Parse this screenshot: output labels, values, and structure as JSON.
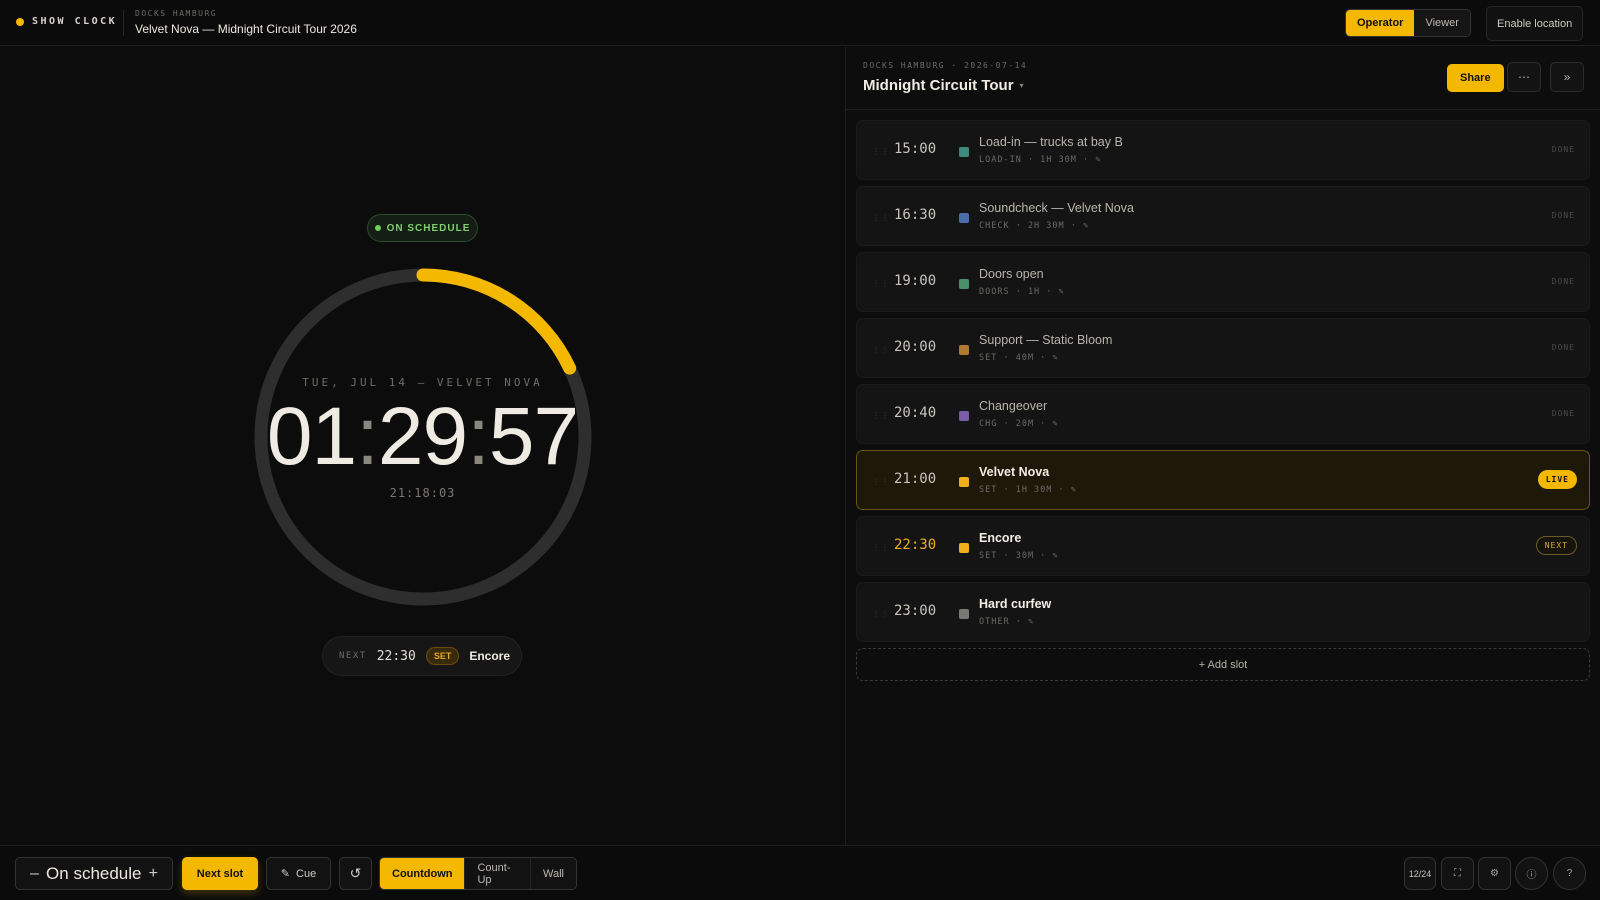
{
  "header": {
    "brand": "SHOW CLOCK",
    "venue": "DOCKS HAMBURG",
    "title": "Velvet Nova — Midnight Circuit Tour 2026",
    "roles": [
      "Operator",
      "Viewer"
    ],
    "active_role": "Operator",
    "enable_location": "Enable location"
  },
  "clock": {
    "status": "ON SCHEDULE",
    "subtitle": "TUE, JUL 14 — VELVET NOVA",
    "hh": "01",
    "mm": "29",
    "ss": "57",
    "separator": ":",
    "current_time": "21:18:03",
    "progress": 0.18,
    "next": {
      "label": "NEXT",
      "time": "22:30",
      "category": "SET",
      "title": "Encore"
    }
  },
  "show": {
    "venue_date": "DOCKS HAMBURG · 2026-07-14",
    "title": "Midnight Circuit Tour",
    "caret": "▾",
    "share": "Share",
    "more_icon": "⋯",
    "collapse_icon": "»",
    "add_slot": "+ Add slot"
  },
  "slots": [
    {
      "time": "15:00",
      "name": "Load-in — trucks at bay B",
      "meta": "LOAD-IN · 1H 30M · ✎",
      "badge": "DONE",
      "state": "done",
      "color": "#3f8a7a"
    },
    {
      "time": "16:30",
      "name": "Soundcheck — Velvet Nova",
      "meta": "CHECK · 2H 30M · ✎",
      "badge": "DONE",
      "state": "done",
      "color": "#4a6fa8"
    },
    {
      "time": "19:00",
      "name": "Doors open",
      "meta": "DOORS · 1H · ✎",
      "badge": "DONE",
      "state": "done",
      "color": "#4a8f6a"
    },
    {
      "time": "20:00",
      "name": "Support — Static Bloom",
      "meta": "SET · 40M · ✎",
      "badge": "DONE",
      "state": "done",
      "color": "#b07a30"
    },
    {
      "time": "20:40",
      "name": "Changeover",
      "meta": "CHG · 20M · ✎",
      "badge": "DONE",
      "state": "done",
      "color": "#7a5ca8"
    },
    {
      "time": "21:00",
      "name": "Velvet Nova",
      "meta": "SET · 1H 30M · ✎",
      "badge": "LIVE",
      "state": "live",
      "color": "#f0ae1c"
    },
    {
      "time": "22:30",
      "name": "Encore",
      "meta": "SET · 30M · ✎",
      "badge": "NEXT",
      "state": "next",
      "color": "#f0ae1c"
    },
    {
      "time": "23:00",
      "name": "Hard curfew",
      "meta": "OTHER · ✎",
      "badge": "",
      "state": "upcoming",
      "color": "#7a7874"
    }
  ],
  "toolbar": {
    "minus": "–",
    "offset_label": "On schedule",
    "plus": "+",
    "next_slot": "Next slot",
    "cue_icon": "✎",
    "cue": "Cue",
    "reset_icon": "↺",
    "modes": [
      "Countdown",
      "Count-Up",
      "Wall"
    ],
    "active_mode": "Countdown",
    "hour_format": "12/24",
    "fullscreen_icon": "⛶",
    "settings_icon": "⚙",
    "info_icon": "ⓘ",
    "help_icon": "?"
  },
  "colors": {
    "accent": "#f5b800",
    "background": "#0c0c0c",
    "on_schedule": "#7fcf6d",
    "ring_track": "#2e2e2e"
  }
}
